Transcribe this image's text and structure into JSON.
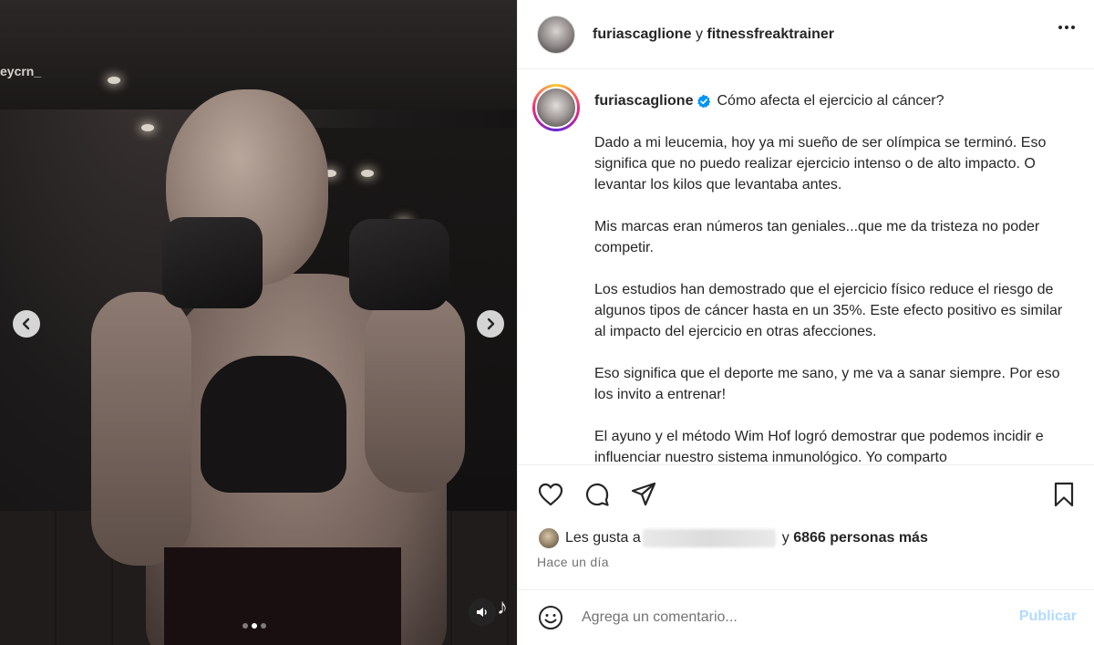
{
  "media": {
    "watermark": "eycrn_",
    "prev_icon": "chevron-left-icon",
    "next_icon": "chevron-right-icon",
    "carousel": {
      "count": 3,
      "active": 1
    },
    "audio_icon": "speaker-icon",
    "tiktok_glyph": "♪"
  },
  "header": {
    "author": "furiascaglione",
    "joiner": "y",
    "collaborator": "fitnessfreaktrainer",
    "more_icon": "more-horizontal-icon"
  },
  "caption": {
    "username": "furiascaglione",
    "verified_icon": "verified-badge-icon",
    "verified_color": "#0095f6",
    "title": "Cómo afecta el ejercicio al cáncer?",
    "paragraphs": [
      "Dado a mi leucemia, hoy ya mi sueño de ser olímpica se terminó. Eso significa que no puedo realizar ejercicio intenso o de alto impacto. O levantar los kilos que levantaba antes.",
      "Mis marcas eran números tan geniales...que me da tristeza no poder competir.",
      "Los estudios han demostrado que el ejercicio físico reduce el riesgo de algunos tipos de cáncer hasta en un 35%. Este efecto positivo es similar al impacto del ejercicio en otras afecciones.",
      "Eso significa que el deporte me sano, y me va a sanar siempre. Por eso los invito a entrenar!",
      "El ayuno y el método Wim Hof logró demostrar que podemos incidir e influenciar nuestro sistema inmunológico. Yo comparto"
    ]
  },
  "actions": {
    "like_icon": "heart-icon",
    "comment_icon": "comment-icon",
    "share_icon": "send-icon",
    "save_icon": "bookmark-icon"
  },
  "likes": {
    "prefix": "Les gusta a",
    "joiner": "y",
    "count_text": "6866 personas más"
  },
  "timestamp": "Hace un día",
  "comment": {
    "emoji_icon": "emoji-icon",
    "placeholder": "Agrega un comentario...",
    "publish_label": "Publicar",
    "publish_color": "#b3dbff"
  }
}
